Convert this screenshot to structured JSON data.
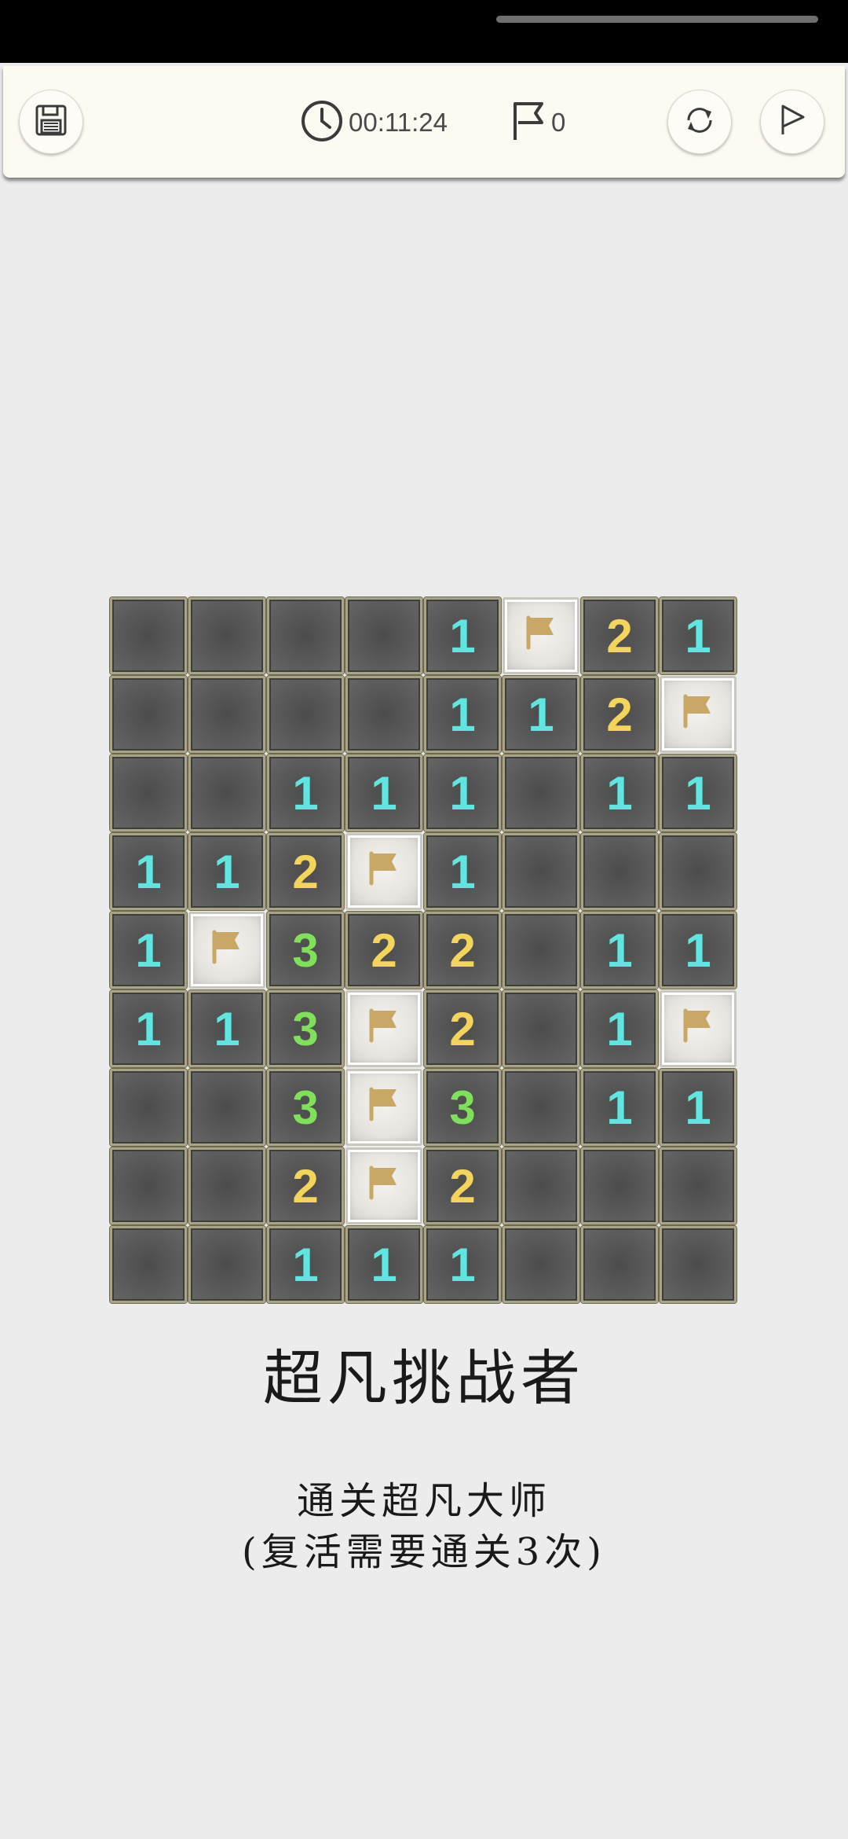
{
  "toolbar": {
    "timer": "00:11:24",
    "flag_count": "0",
    "icons": {
      "save": "floppy-disk-icon",
      "clock": "clock-icon",
      "flag": "flag-icon",
      "restart": "refresh-icon",
      "play": "flag-mode-icon"
    }
  },
  "board": {
    "rows": 9,
    "cols": 8,
    "grid": [
      [
        "",
        "",
        "",
        "",
        "1",
        "F",
        "2",
        "1"
      ],
      [
        "",
        "",
        "",
        "",
        "1",
        "1",
        "2",
        "F"
      ],
      [
        "",
        "",
        "1",
        "1",
        "1",
        "",
        "1",
        "1"
      ],
      [
        "1",
        "1",
        "2",
        "F",
        "1",
        "",
        "",
        ""
      ],
      [
        "1",
        "F",
        "3",
        "2",
        "2",
        "",
        "1",
        "1"
      ],
      [
        "1",
        "1",
        "3",
        "F",
        "2",
        "",
        "1",
        "F"
      ],
      [
        "",
        "",
        "3",
        "F",
        "3",
        "",
        "1",
        "1"
      ],
      [
        "",
        "",
        "2",
        "F",
        "2",
        "",
        "",
        ""
      ],
      [
        "",
        "",
        "1",
        "1",
        "1",
        "",
        "",
        ""
      ]
    ],
    "colors": {
      "1": "#5fe6e0",
      "2": "#f2d55a",
      "3": "#7fe05a",
      "flag": "#c9a865"
    }
  },
  "level": {
    "title": "超凡挑战者",
    "line1": "通关超凡大师",
    "line2": "(复活需要通关3次)"
  }
}
